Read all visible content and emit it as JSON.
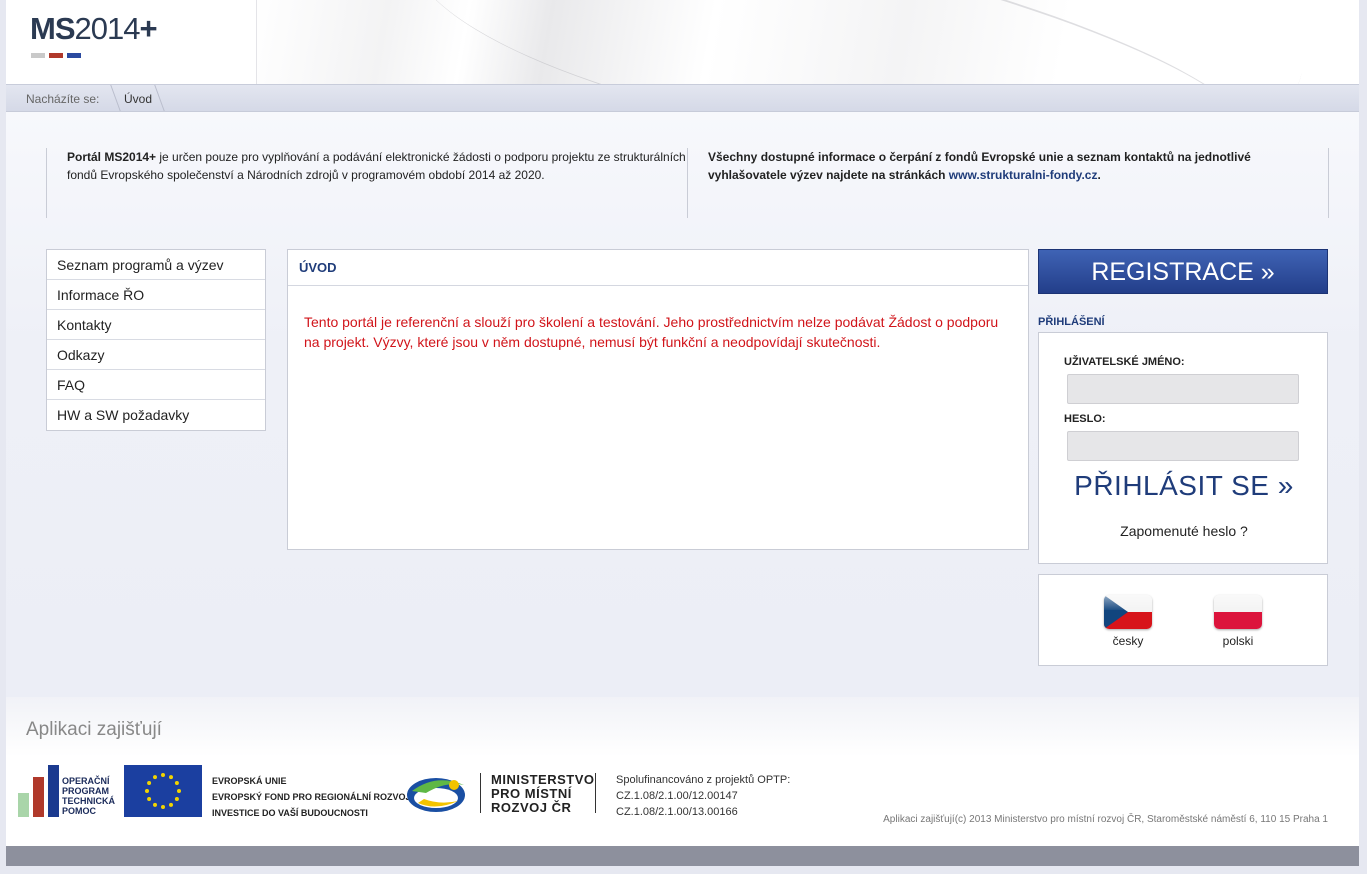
{
  "header": {
    "logo_ms": "MS",
    "logo_year": "2014",
    "logo_plus": "+",
    "logo_bar_colors": [
      "#c9c9c9",
      "#b0392b",
      "#2b4aa0"
    ]
  },
  "breadcrumb": {
    "label": "Nacházíte se:",
    "current": "Úvod"
  },
  "info": {
    "left_bold": "Portál MS2014+",
    "left_text": " je určen pouze pro vyplňování a podávání elektronické žádosti o podporu projektu ze strukturálních fondů Evropského společenství a Národních zdrojů v programovém období 2014 až 2020.",
    "right_text": "Všechny dostupné informace o čerpání z fondů Evropské unie a seznam kontaktů na jednotlivé vyhlašovatele výzev najdete na stránkách ",
    "right_link": "www.strukturalni-fondy.cz",
    "right_end": "."
  },
  "menu": {
    "items": [
      {
        "label": "Seznam programů a výzev"
      },
      {
        "label": "Informace ŘO"
      },
      {
        "label": "Kontakty"
      },
      {
        "label": "Odkazy"
      },
      {
        "label": "FAQ"
      },
      {
        "label": "HW a SW požadavky"
      }
    ]
  },
  "panel": {
    "title": "ÚVOD",
    "text": "Tento portál je referenční a slouží pro školení a testování. Jeho prostřednictvím nelze podávat Žádost o podporu na projekt. Výzvy, které jsou v něm dostupné, nemusí být funkční a neodpovídají skutečnosti."
  },
  "registration": {
    "label": "REGISTRACE »"
  },
  "login": {
    "heading": "PŘIHLÁŠENÍ",
    "username_label": "UŽIVATELSKÉ JMÉNO:",
    "username_value": "",
    "password_label": "HESLO:",
    "password_value": "",
    "submit_label": "PŘIHLÁSIT SE »",
    "forgot_label": "Zapomenuté heslo ?"
  },
  "languages": [
    {
      "label": "česky",
      "icon": "czech-flag-icon"
    },
    {
      "label": "polski",
      "icon": "polish-flag-icon"
    }
  ],
  "footer": {
    "title": "Aplikaci zajišťují",
    "optp_lines": [
      "OPERAČNÍ",
      "PROGRAM",
      "TECHNICKÁ",
      "POMOC"
    ],
    "eu_lines": [
      "EVROPSKÁ UNIE",
      "EVROPSKÝ FOND PRO REGIONÁLNÍ ROZVOJ",
      "INVESTICE DO VAŠÍ BUDOUCNOSTI"
    ],
    "mmr_lines": [
      "MINISTERSTVO",
      "PRO MÍSTNÍ",
      "ROZVOJ ČR"
    ],
    "cofin_lines": [
      "Spolufinancováno z projektů OPTP:",
      "CZ.1.08/2.1.00/12.00147",
      "CZ.1.08/2.1.00/13.00166"
    ],
    "copyright": "Aplikaci zajišťují(c) 2013 Ministerstvo pro místní rozvoj ČR, Staroměstské náměstí 6, 110 15 Praha 1"
  }
}
